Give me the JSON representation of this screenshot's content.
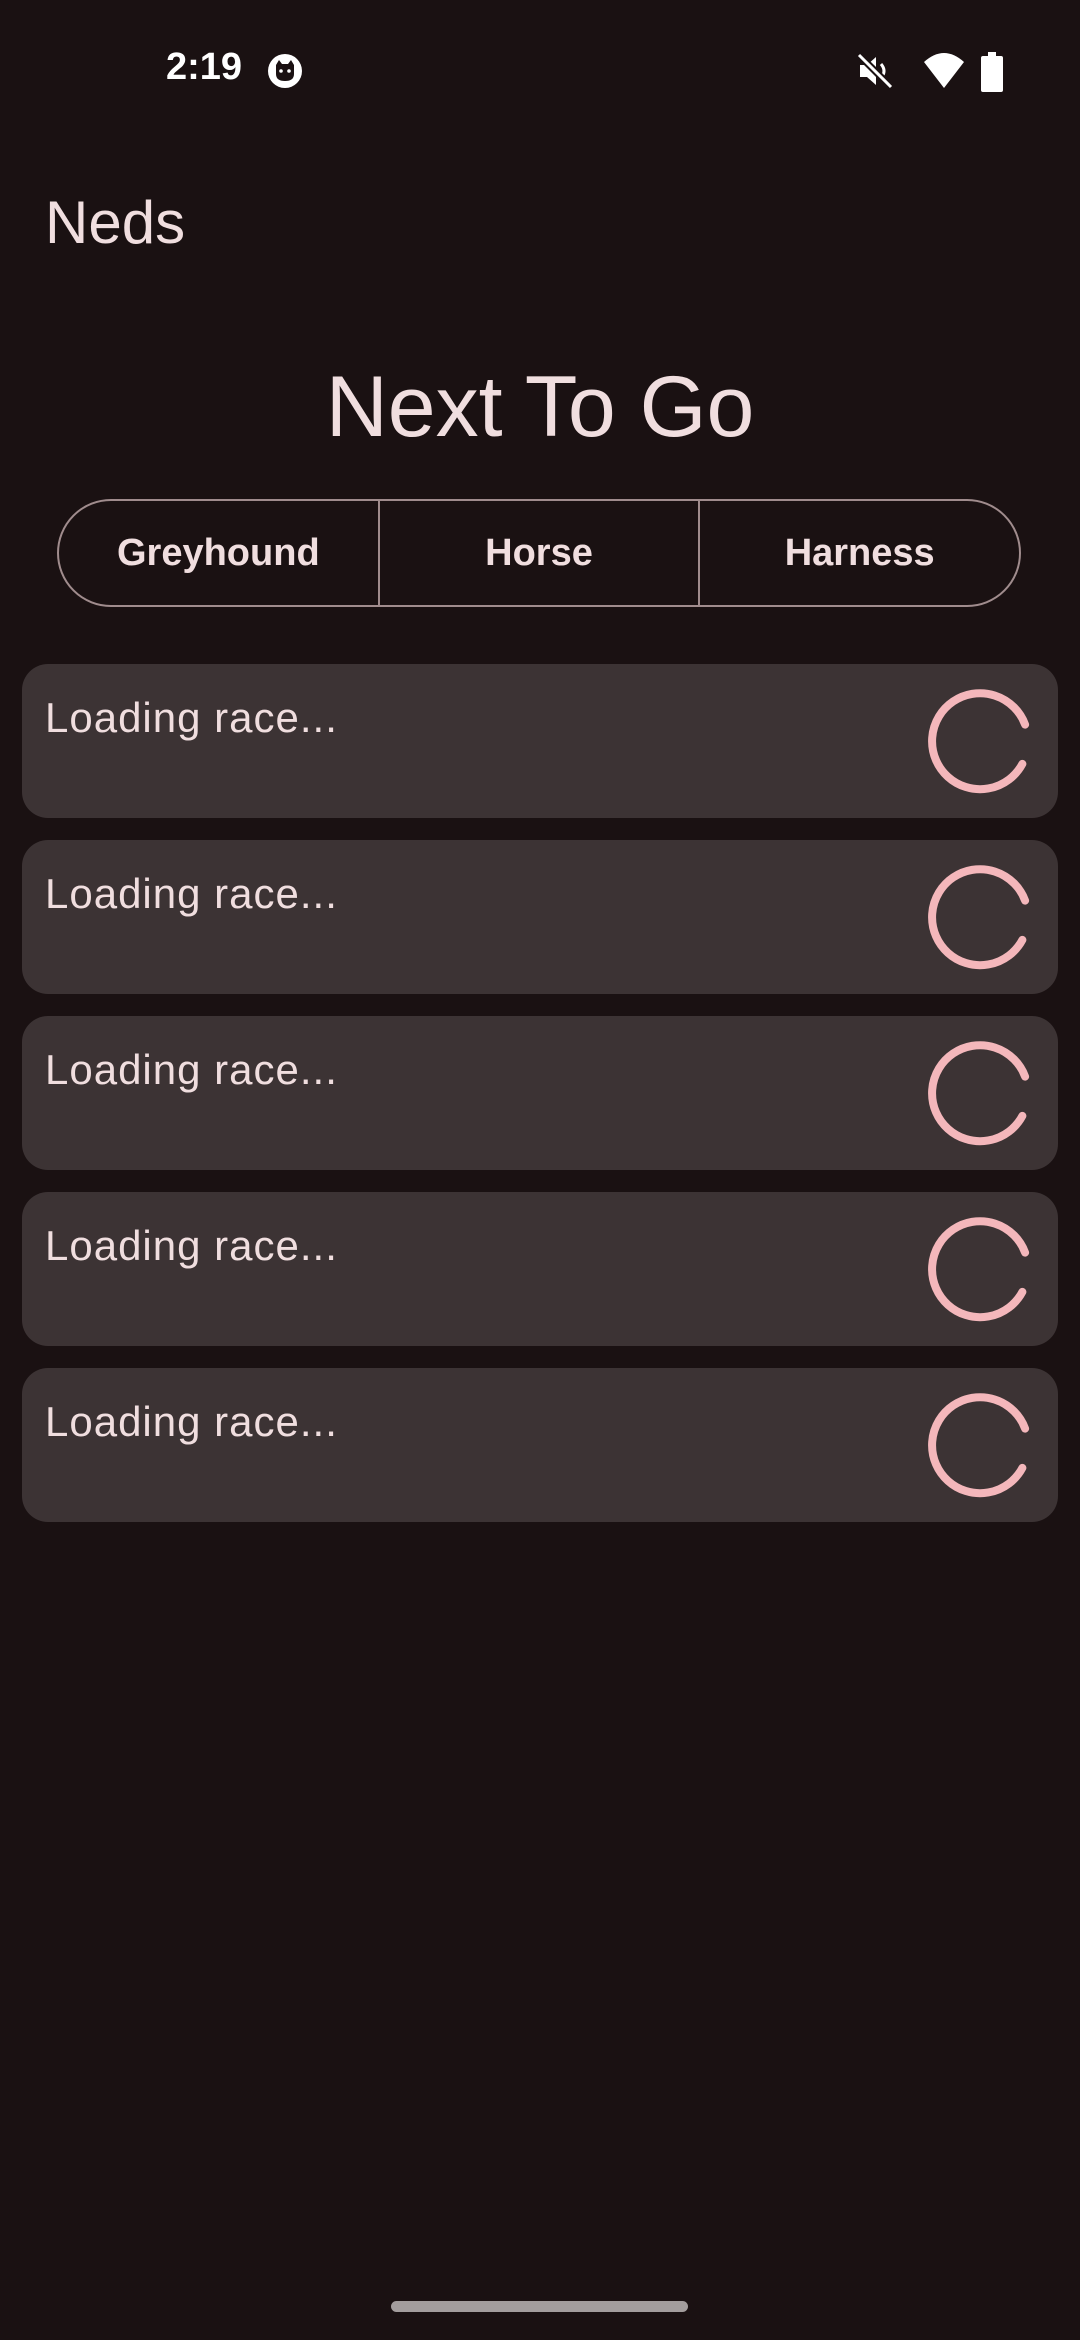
{
  "status_bar": {
    "time": "2:19",
    "icons": [
      "cat-notification-icon",
      "mute-icon",
      "wifi-icon",
      "battery-icon"
    ]
  },
  "app": {
    "title": "Neds"
  },
  "main": {
    "heading": "Next To Go",
    "filters": [
      {
        "label": "Greyhound"
      },
      {
        "label": "Horse"
      },
      {
        "label": "Harness"
      }
    ],
    "races": [
      {
        "label": "Loading race...",
        "state": "loading"
      },
      {
        "label": "Loading race...",
        "state": "loading"
      },
      {
        "label": "Loading race...",
        "state": "loading"
      },
      {
        "label": "Loading race...",
        "state": "loading"
      },
      {
        "label": "Loading race...",
        "state": "loading"
      }
    ]
  },
  "colors": {
    "background": "#1a1112",
    "card": "#3c3334",
    "text": "#f0dedf",
    "accent_spinner": "#f4b7bb",
    "outline": "#a08c8d"
  }
}
